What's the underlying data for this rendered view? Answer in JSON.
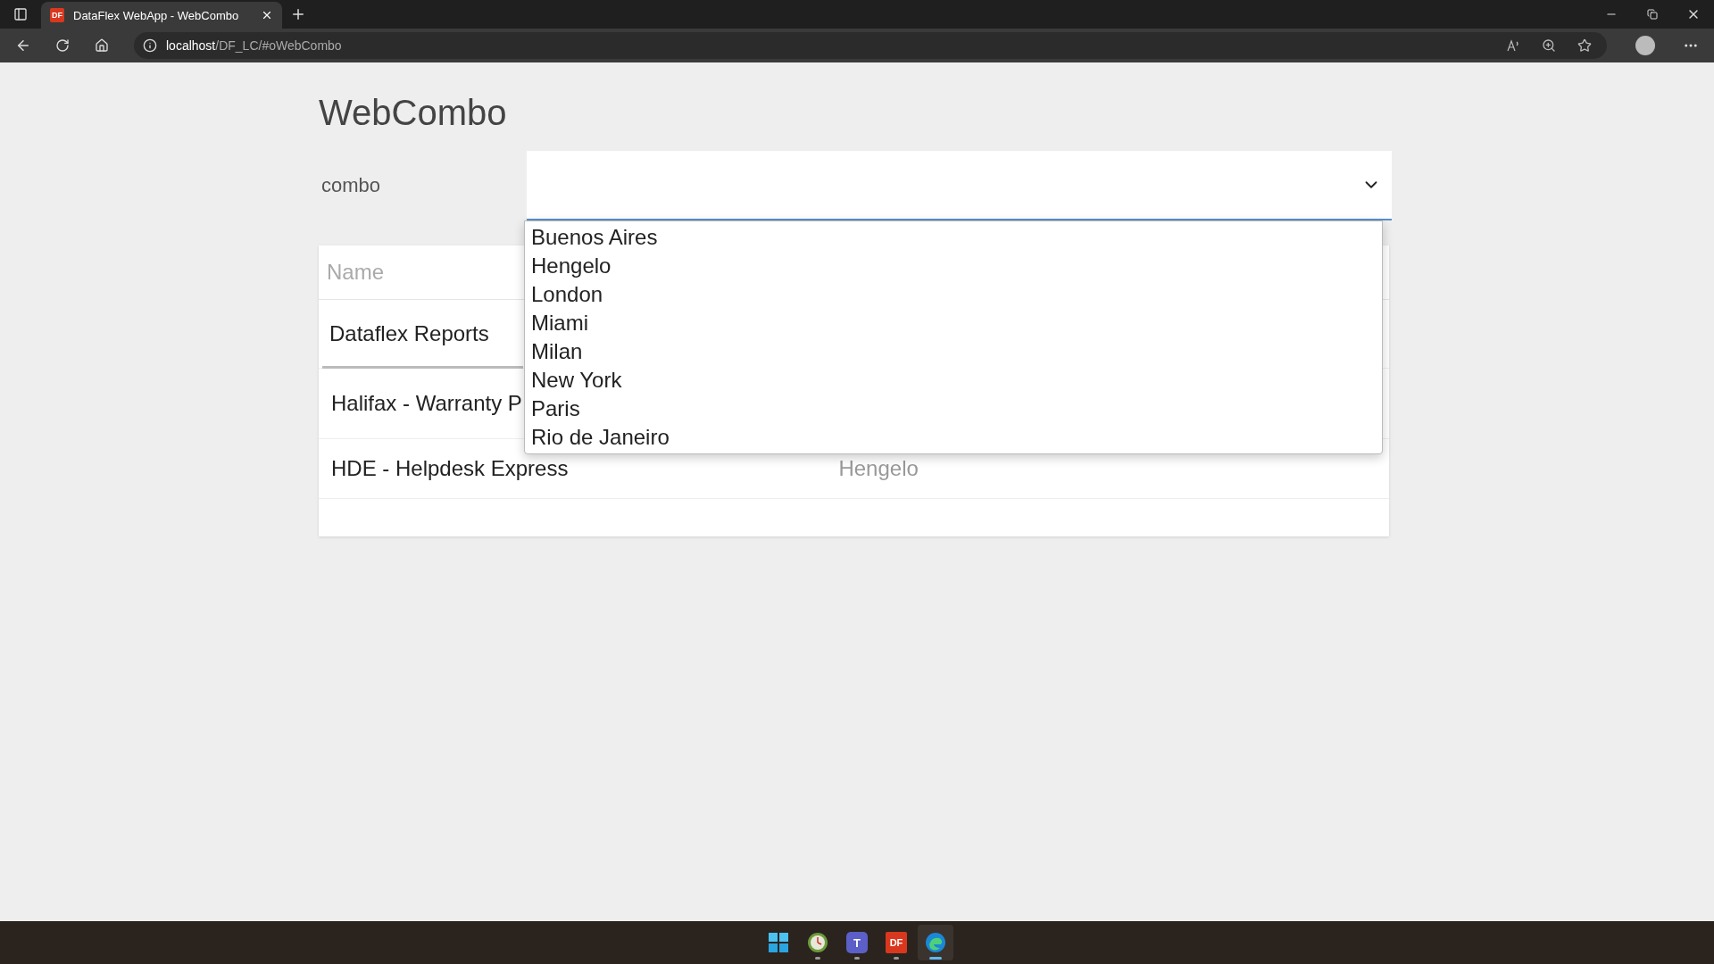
{
  "browser": {
    "tab": {
      "favicon": "DF",
      "title": "DataFlex WebApp - WebCombo",
      "selected": true
    },
    "address": {
      "host": "localhost",
      "path": "/DF_LC/#oWebCombo"
    }
  },
  "page": {
    "title": "WebCombo"
  },
  "combo": {
    "label": "combo",
    "expanded": true,
    "options": [
      {
        "label": "Buenos Aires",
        "selected": false
      },
      {
        "label": "Hengelo",
        "selected": false
      },
      {
        "label": "London",
        "selected": false
      },
      {
        "label": "Miami",
        "selected": false
      },
      {
        "label": "Milan",
        "selected": false
      },
      {
        "label": "New York",
        "selected": false
      },
      {
        "label": "Paris",
        "selected": false
      },
      {
        "label": "Rio de Janeiro",
        "selected": false
      }
    ]
  },
  "table": {
    "columns": [
      "Name"
    ],
    "rows": [
      {
        "cells": [
          "Dataflex Reports"
        ],
        "selected": true
      },
      {
        "cells": [
          "Halifax - Warranty P"
        ],
        "selected": false
      },
      {
        "cells": [
          "HDE - Helpdesk Express",
          "Hengelo"
        ],
        "selected": false
      }
    ]
  },
  "taskbar": {
    "apps": [
      {
        "kind": "start",
        "active": false
      },
      {
        "kind": "clock",
        "active": true
      },
      {
        "kind": "teams",
        "label": "T",
        "active": true
      },
      {
        "kind": "df",
        "label": "DF",
        "active": true
      },
      {
        "kind": "edge",
        "active": true,
        "selected": true
      }
    ]
  }
}
